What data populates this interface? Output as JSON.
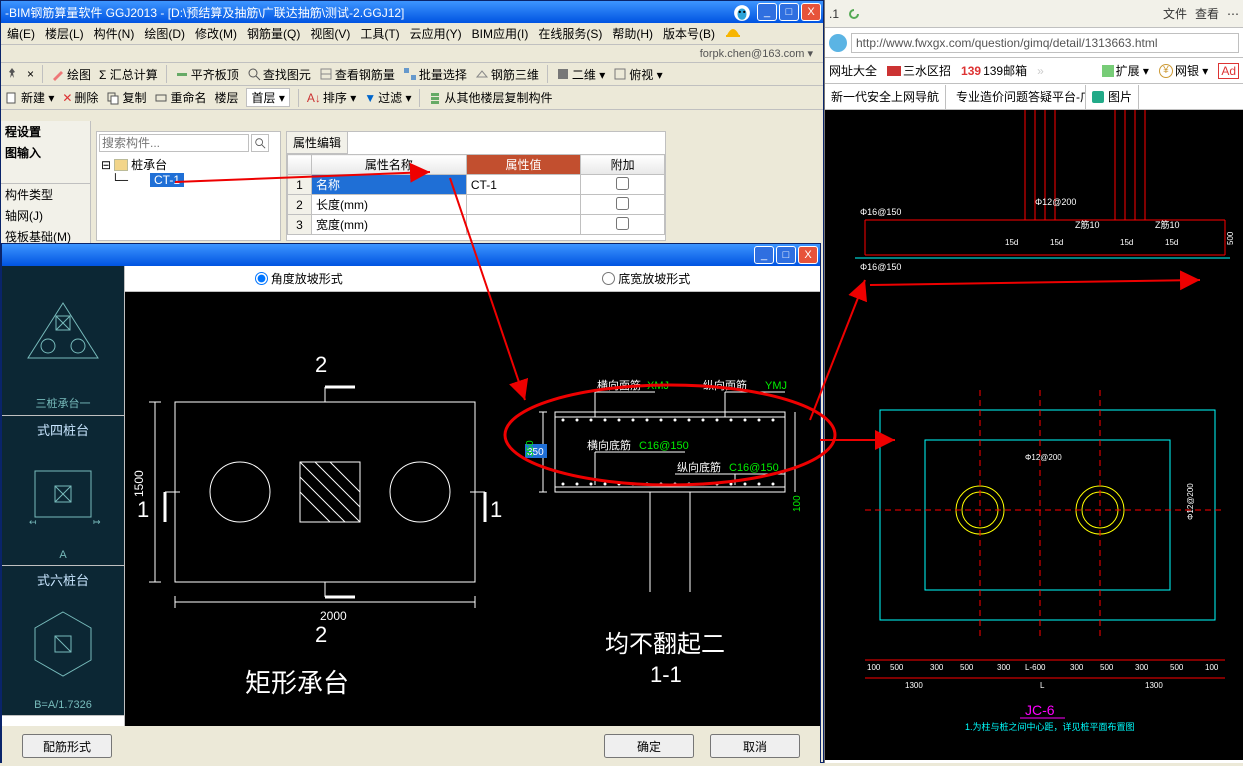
{
  "app": {
    "title": "-BIM钢筋算量软件 GGJ2013 - [D:\\预结算及抽筋\\广联达抽筋\\测试-2.GGJ12]",
    "login": "forpk.chen@163.com ▾"
  },
  "menu": [
    "编(E)",
    "楼层(L)",
    "构件(N)",
    "绘图(D)",
    "修改(M)",
    "钢筋量(Q)",
    "视图(V)",
    "工具(T)",
    "云应用(Y)",
    "BIM应用(I)",
    "在线服务(S)",
    "帮助(H)",
    "版本号(B)"
  ],
  "toolbar1": {
    "draw": "绘图",
    "sigma": "Σ 汇总计算",
    "level_board": "平齐板顶",
    "find_graph": "查找图元",
    "view_rebar": "查看钢筋量",
    "batch_sel": "批量选择",
    "three_d": "钢筋三维",
    "two_d_sel": "二维 ▾",
    "overlook": "俯视 ▾"
  },
  "toolbar2": {
    "new": "新建 ▾",
    "delete": "删除",
    "copy": "复制",
    "rename": "重命名",
    "floor_sel": "楼层",
    "first_floor": "首层 ▾",
    "sort": "排序 ▾",
    "filter": "过滤 ▾",
    "copy_other": "从其他楼层复制构件"
  },
  "nav": {
    "header1": "程设置",
    "header2": "图输入",
    "items": [
      "构件类型",
      "轴网(J)",
      "筏板基础(M)"
    ]
  },
  "tree": {
    "search_ph": "搜索构件...",
    "root": "桩承台",
    "leaf": "CT-1"
  },
  "prop": {
    "tab": "属性编辑",
    "cols": [
      "",
      "属性名称",
      "属性值",
      "附加"
    ],
    "rows": [
      {
        "n": "1",
        "name": "名称",
        "value": "CT-1",
        "chk": false,
        "sel": true
      },
      {
        "n": "2",
        "name": "长度(mm)",
        "value": "",
        "chk": false
      },
      {
        "n": "3",
        "name": "宽度(mm)",
        "value": "",
        "chk": false
      }
    ]
  },
  "dialog": {
    "radios": {
      "angle": "角度放坡形式",
      "width": "底宽放坡形式"
    },
    "thumbs": [
      {
        "label": "三桩承台一"
      },
      {
        "label": "A",
        "sub": "式四桩台"
      },
      {
        "label": "B=A/1.7326",
        "sub": "式六桩台"
      }
    ],
    "plan": {
      "title": "矩形承台",
      "dim_w": "2000",
      "dim_h": "1500",
      "marks": [
        "1",
        "1",
        "2",
        "2"
      ]
    },
    "section": {
      "title": "均不翻起二",
      "sub": "1-1",
      "h_face": "横向面筋",
      "h_face_v": "XMJ",
      "v_face": "纵向面筋",
      "v_face_v": "YMJ",
      "h_bot": "横向底筋",
      "h_bot_v": "C16@150",
      "v_bot": "纵向底筋",
      "v_bot_v": "C16@150",
      "dim_h": "350",
      "dim_b": "100",
      "dim_c": "350"
    },
    "buttons": {
      "cfg": "配筋形式",
      "ok": "确定",
      "cancel": "取消"
    }
  },
  "browser": {
    "top_version": ".1",
    "top_menu": [
      "文件",
      "查看"
    ],
    "url": "http://www.fwxgx.com/question/gimq/detail/1313663.html",
    "fav": [
      {
        "t": "网址大全"
      },
      {
        "t": "三水区招"
      },
      {
        "t": "139邮箱"
      },
      {
        "t": "扩展 ▾"
      },
      {
        "t": "网银 ▾"
      },
      {
        "t": "Ad"
      }
    ],
    "tabs": [
      {
        "t": "新一代安全上网导航"
      },
      {
        "t": "专业造价问题答疑平台-广联达"
      },
      {
        "t": "图片"
      }
    ]
  },
  "cad_right": {
    "top_labels": [
      "Φ16@150",
      "Φ12@200",
      "Z筋10",
      "Z筋10"
    ],
    "top_dims": [
      "15d",
      "15d",
      "15d",
      "15d"
    ],
    "side": "500",
    "grid_dims": [
      "100",
      "500",
      "300",
      "500",
      "300",
      "L-600",
      "300",
      "500",
      "300",
      "500",
      "100"
    ],
    "grid_span": [
      "1300",
      "L",
      "1300"
    ],
    "plan_dims": [
      "Φ12@200",
      "Φ12@200"
    ],
    "name": "JC-6",
    "note": "1.为柱与桩之间中心距，详见桩平面布置图"
  }
}
